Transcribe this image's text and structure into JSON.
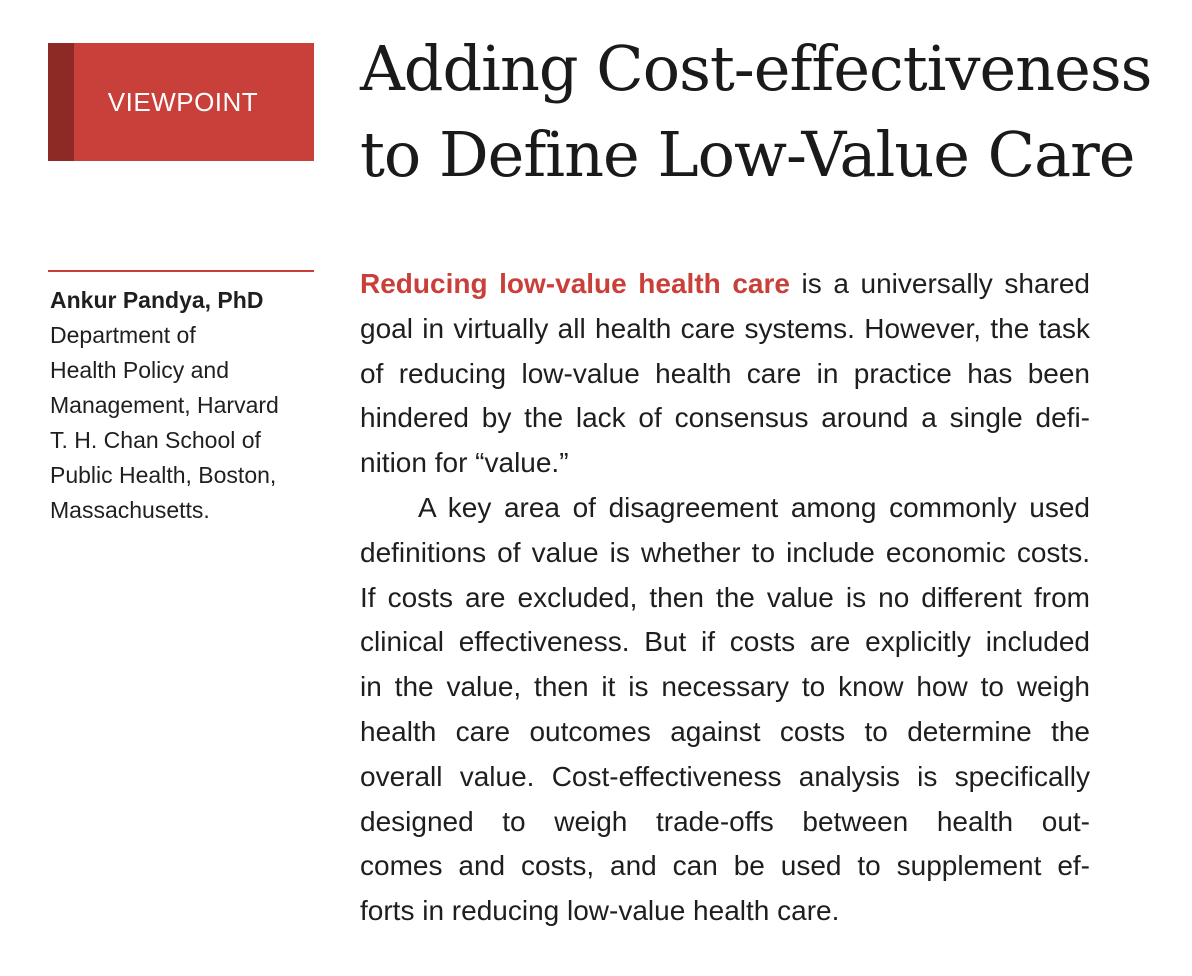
{
  "badge": {
    "label": "VIEWPOINT"
  },
  "title": {
    "line1": "Adding Cost-effectiveness",
    "line2": "to Define Low-Value Care"
  },
  "author": {
    "name": "Ankur Pandya, PhD",
    "affiliation_lines": [
      "Department of",
      "Health Policy and",
      "Management, Harvard",
      "T. H. Chan School of",
      "Public Health, Boston,",
      "Massachusetts."
    ]
  },
  "article": {
    "lead_phrase": "Reducing low-value health care",
    "p1_lines": [
      " is a universally shared",
      "goal in virtually all health care systems. However, the task",
      "of reducing low-value health care in practice has been",
      "hindered by the lack of consensus around a single defi-",
      "nition for “value.”"
    ],
    "p2_lines": [
      "A key area of disagreement among commonly used",
      "definitions of value is whether to include economic costs.",
      "If costs are excluded, then the value is no different from",
      "clinical effectiveness. But if costs are explicitly included",
      "in the value, then it is necessary to know how to weigh",
      "health care outcomes against costs to determine the",
      "overall value. Cost-effectiveness analysis is specifically",
      "designed to weigh trade-offs between health out-",
      "comes and costs, and can be used to supplement ef-",
      "forts in reducing low-value health care."
    ]
  },
  "colors": {
    "accent": "#c9403a",
    "accent_dark": "#8e2a26",
    "text": "#1e1e1e"
  }
}
